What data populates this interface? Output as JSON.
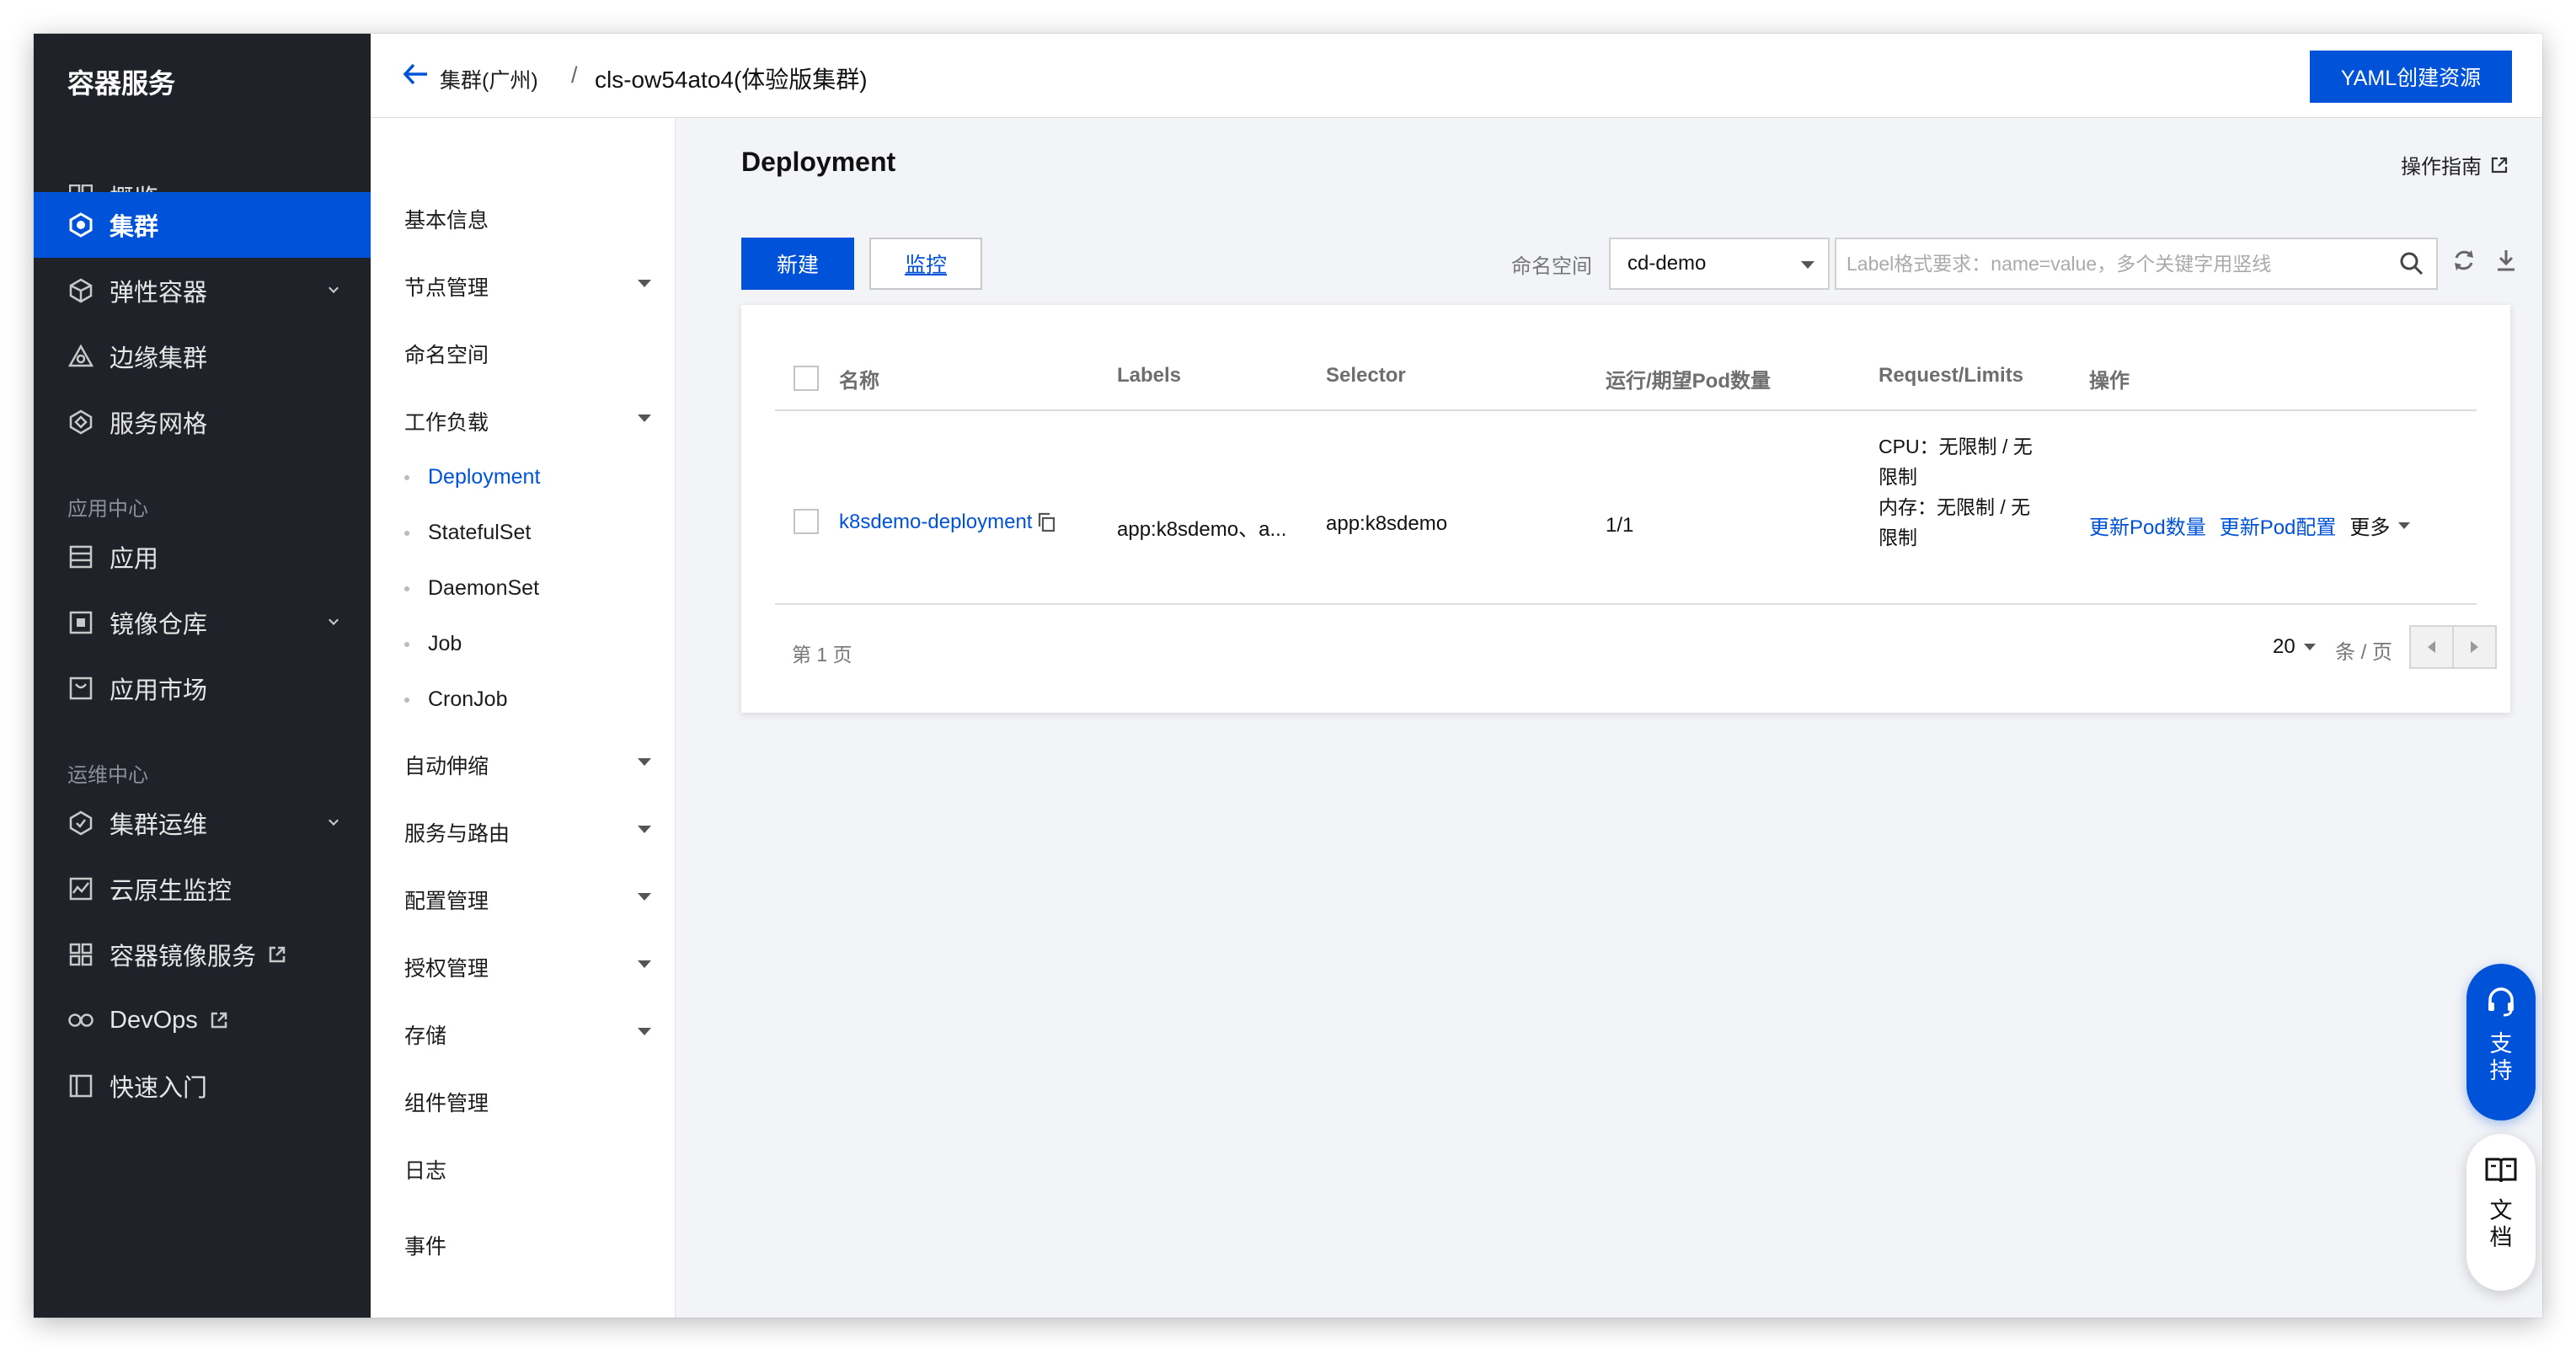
{
  "nav": {
    "title": "容器服务",
    "items": [
      {
        "label": "概览"
      },
      {
        "label": "集群"
      },
      {
        "label": "弹性容器"
      },
      {
        "label": "边缘集群"
      },
      {
        "label": "服务网格"
      }
    ],
    "group_app": "应用中心",
    "app_items": [
      {
        "label": "应用"
      },
      {
        "label": "镜像仓库"
      },
      {
        "label": "应用市场"
      }
    ],
    "group_ops": "运维中心",
    "ops_items": [
      {
        "label": "集群运维"
      },
      {
        "label": "云原生监控"
      },
      {
        "label": "容器镜像服务"
      },
      {
        "label": "DevOps"
      },
      {
        "label": "快速入门"
      }
    ]
  },
  "header": {
    "breadcrumb_parent": "集群(广州)",
    "separator": "/",
    "cluster_name": "cls-ow54ato4(体验版集群)",
    "yaml_button": "YAML创建资源"
  },
  "subnav": {
    "items": [
      {
        "label": "基本信息"
      },
      {
        "label": "节点管理"
      },
      {
        "label": "命名空间"
      },
      {
        "label": "工作负载"
      }
    ],
    "workload_children": [
      {
        "label": "Deployment"
      },
      {
        "label": "StatefulSet"
      },
      {
        "label": "DaemonSet"
      },
      {
        "label": "Job"
      },
      {
        "label": "CronJob"
      }
    ],
    "more_items": [
      {
        "label": "自动伸缩"
      },
      {
        "label": "服务与路由"
      },
      {
        "label": "配置管理"
      },
      {
        "label": "授权管理"
      },
      {
        "label": "存储"
      },
      {
        "label": "组件管理"
      },
      {
        "label": "日志"
      },
      {
        "label": "事件"
      }
    ]
  },
  "main": {
    "title": "Deployment",
    "guide_link": "操作指南",
    "new_button": "新建",
    "monitor_button": "监控",
    "namespace_label": "命名空间",
    "namespace_value": "cd-demo",
    "search_placeholder": "Label格式要求：name=value，多个关键字用竖线",
    "table": {
      "columns": [
        "名称",
        "Labels",
        "Selector",
        "运行/期望Pod数量",
        "Request/Limits",
        "操作"
      ],
      "rows": [
        {
          "name": "k8sdemo-deployment",
          "labels": "app:k8sdemo、a...",
          "selector": "app:k8sdemo",
          "pods": "1/1",
          "request_line1": "CPU：无限制 / 无",
          "request_line2": "限制",
          "request_line3": "内存：无限制 / 无",
          "request_line4": "限制",
          "action1": "更新Pod数量",
          "action2": "更新Pod配置",
          "action_more": "更多"
        }
      ]
    },
    "footer": {
      "page_text": "第 1 页",
      "page_size": "20",
      "per_page": "条 / 页"
    }
  },
  "floating": {
    "support": "支持",
    "docs": "文档"
  },
  "colors": {
    "primary": "#0052d9",
    "nav_bg": "#1f2329",
    "content_bg": "#f3f4f7"
  }
}
